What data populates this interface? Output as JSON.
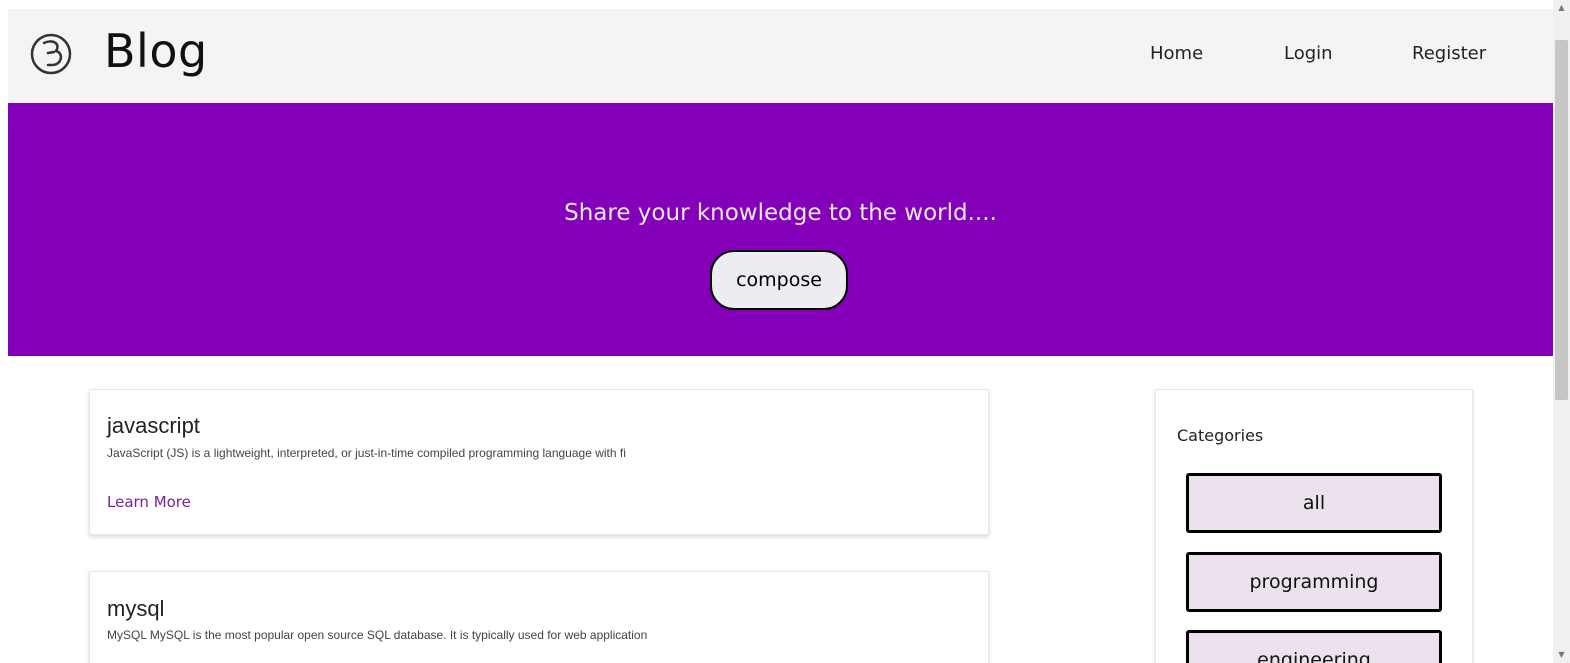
{
  "header": {
    "brand": "Blog",
    "logo_icon": "b-circle-logo-icon",
    "nav": [
      {
        "label": "Home"
      },
      {
        "label": "Login"
      },
      {
        "label": "Register"
      }
    ]
  },
  "hero": {
    "tagline": "Share your knowledge to the world....",
    "compose_label": "compose",
    "background_color": "#8400b8"
  },
  "posts": [
    {
      "title": "javascript",
      "excerpt": "JavaScript (JS) is a lightweight, interpreted, or just-in-time compiled programming language with fi",
      "link_label": "Learn More"
    },
    {
      "title": "mysql",
      "excerpt": "MySQL MySQL is the most popular open source SQL database. It is typically used for web application"
    }
  ],
  "sidebar": {
    "title": "Categories",
    "categories": [
      "all",
      "programming",
      "engineering"
    ]
  },
  "scrollbar": {
    "up_icon": "scroll-up-arrow-icon",
    "down_icon": "scroll-down-arrow-icon"
  }
}
